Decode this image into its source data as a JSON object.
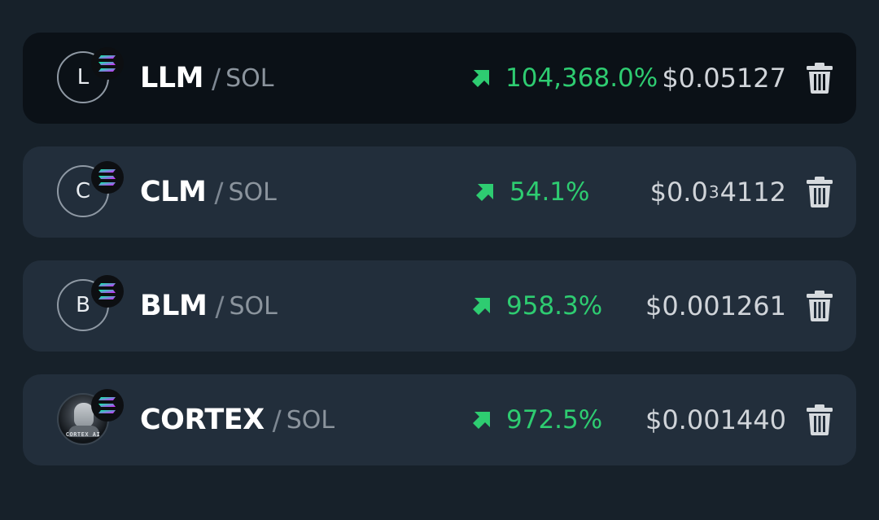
{
  "watchlist": [
    {
      "avatar_letter": "L",
      "symbol": "LLM",
      "separator": "/",
      "quote": "SOL",
      "change": "104,368.0%",
      "price_prefix": "$0.05127",
      "price_sub": "",
      "price_suffix": "",
      "active": true,
      "chain_icon": "solana-icon",
      "trend_icon": "trend-up-icon",
      "delete_icon": "trash-icon"
    },
    {
      "avatar_letter": "C",
      "symbol": "CLM",
      "separator": "/",
      "quote": "SOL",
      "change": "54.1%",
      "price_prefix": "$0.0",
      "price_sub": "3",
      "price_suffix": "4112",
      "active": false,
      "chain_icon": "solana-icon",
      "trend_icon": "trend-up-icon",
      "delete_icon": "trash-icon"
    },
    {
      "avatar_letter": "B",
      "symbol": "BLM",
      "separator": "/",
      "quote": "SOL",
      "change": "958.3%",
      "price_prefix": "$0.001261",
      "price_sub": "",
      "price_suffix": "",
      "active": false,
      "chain_icon": "solana-icon",
      "trend_icon": "trend-up-icon",
      "delete_icon": "trash-icon"
    },
    {
      "avatar_letter": "",
      "avatar_logo_text": "CORTEX AI",
      "symbol": "CORTEX",
      "separator": "/",
      "quote": "SOL",
      "change": "972.5%",
      "price_prefix": "$0.001440",
      "price_sub": "",
      "price_suffix": "",
      "active": false,
      "chain_icon": "solana-icon",
      "trend_icon": "trend-up-icon",
      "delete_icon": "trash-icon"
    }
  ],
  "colors": {
    "background": "#17212a",
    "row": "#222e3b",
    "row_active": "#0b1117",
    "positive": "#2ecc71",
    "price_text": "#d0d4d9",
    "quote_text": "#8b949d"
  }
}
